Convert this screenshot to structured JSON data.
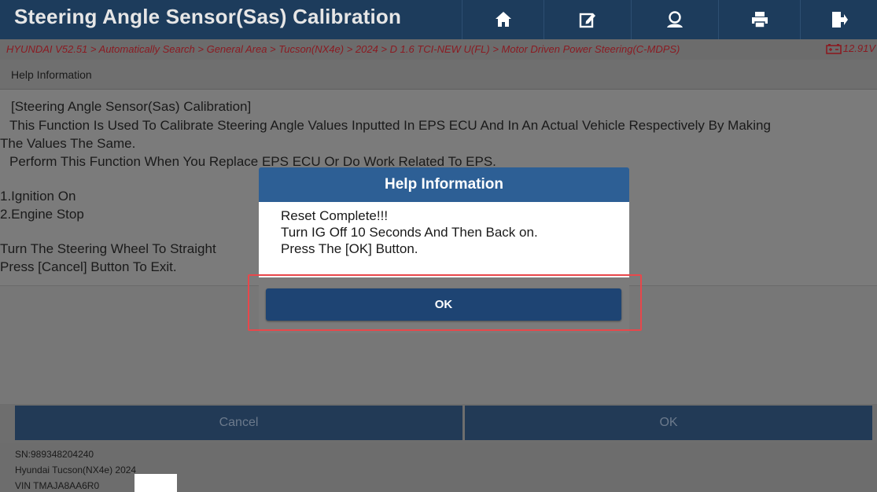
{
  "header": {
    "title": "Steering Angle Sensor(Sas) Calibration",
    "icons": [
      "home-icon",
      "edit-report-icon",
      "user-help-icon",
      "print-icon",
      "exit-icon"
    ]
  },
  "breadcrumb": {
    "path": "HYUNDAI V52.51 > Automatically Search > General Area > Tucson(NX4e) > 2024 > D 1.6 TCI-NEW U(FL) > Motor Driven Power Steering(C-MDPS)",
    "voltage": "12.91V"
  },
  "help_section": {
    "heading": "Help Information",
    "lines": [
      "[Steering Angle Sensor(Sas) Calibration]",
      " This Function Is Used To Calibrate Steering Angle Values Inputted In EPS ECU And In An Actual Vehicle Respectively By Making",
      "The Values The Same.",
      " Perform This Function When You Replace EPS ECU Or Do Work Related To EPS.",
      "1.Ignition On",
      "2.Engine Stop",
      "Turn The Steering Wheel To Straight",
      "Press [Cancel] Button To Exit."
    ]
  },
  "buttons": {
    "cancel": "Cancel",
    "ok": "OK"
  },
  "footer": {
    "sn": "SN:989348204240",
    "vehicle": "Hyundai Tucson(NX4e) 2024",
    "vin": "VIN TMAJA8AA6R0"
  },
  "dialog": {
    "title": "Help Information",
    "lines": [
      "Reset Complete!!!",
      "Turn IG Off 10 Seconds And Then Back on.",
      "Press The [OK] Button."
    ],
    "ok": "OK"
  },
  "colors": {
    "header_bg": "#1d3c5c",
    "breadcrumb_text": "#8a1b22",
    "dialog_title_bg": "#2d5f95",
    "dialog_button_bg": "#1e4473",
    "highlight_border": "#e8474b"
  }
}
